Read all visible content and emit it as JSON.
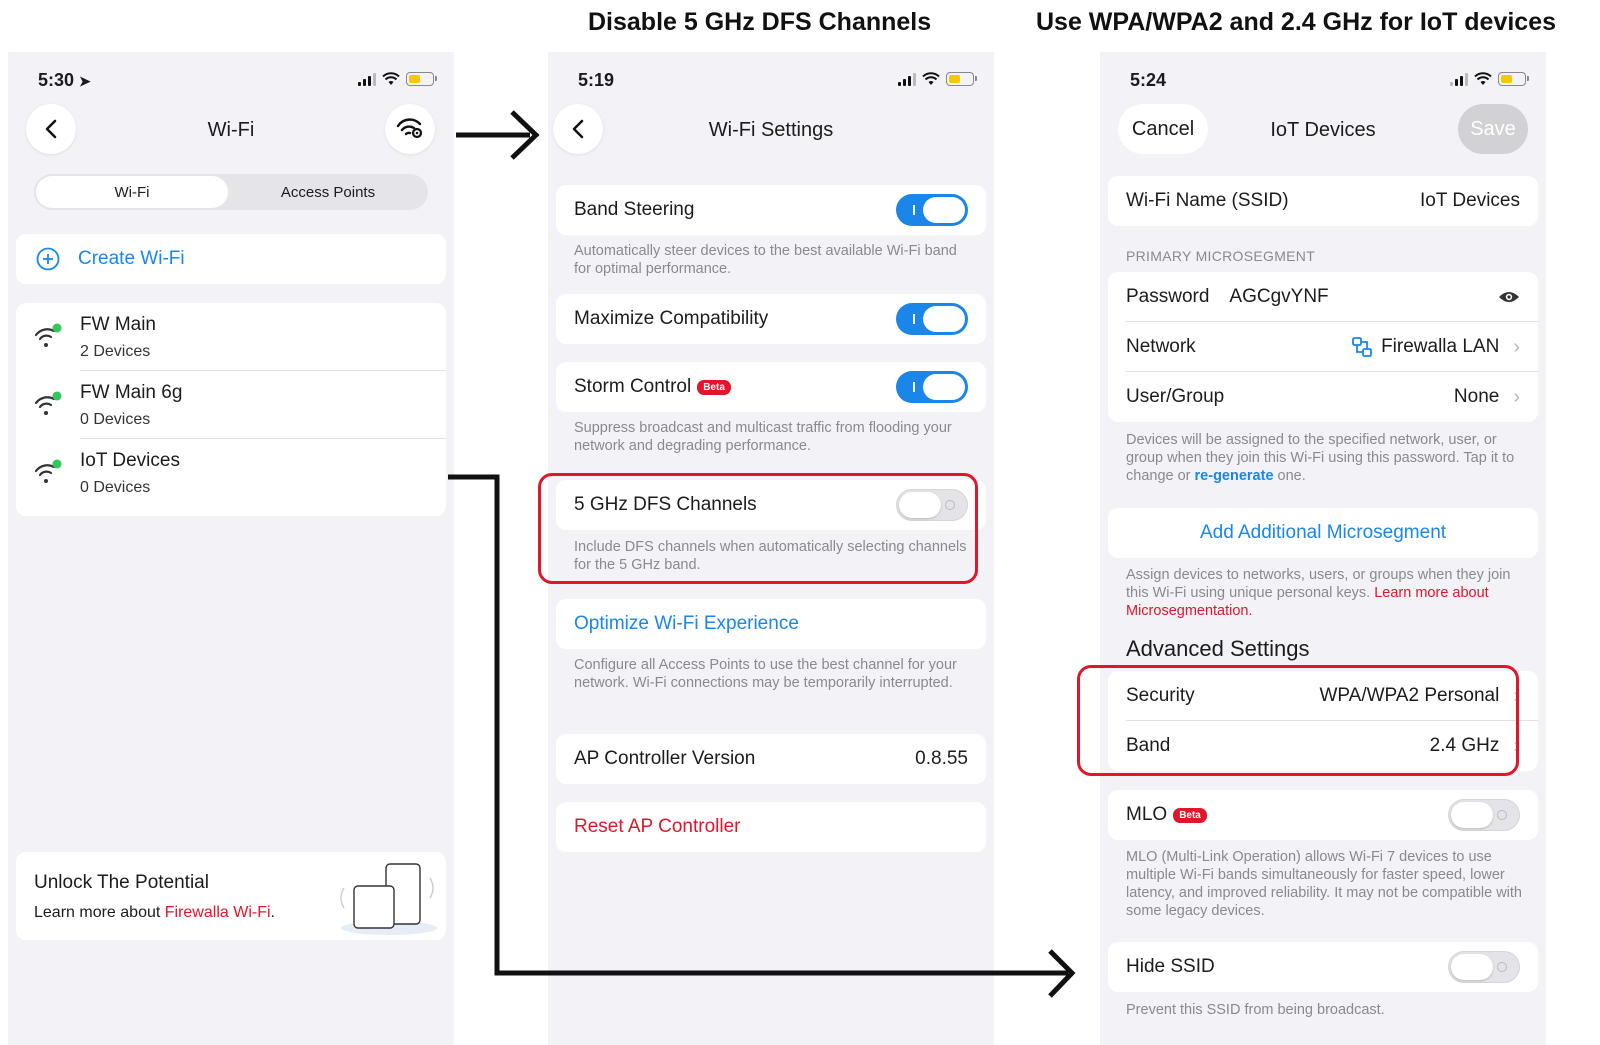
{
  "headings": {
    "middle": "Disable 5 GHz DFS Channels",
    "right": "Use WPA/WPA2 and 2.4 GHz for IoT devices"
  },
  "phone1": {
    "time": "5:30",
    "title": "Wi-Fi",
    "tabs": [
      "Wi-Fi",
      "Access Points"
    ],
    "create_label": "Create Wi-Fi",
    "networks": [
      {
        "name": "FW Main",
        "devices": "2 Devices"
      },
      {
        "name": "FW Main 6g",
        "devices": "0 Devices"
      },
      {
        "name": "IoT Devices",
        "devices": "0 Devices"
      }
    ],
    "promo": {
      "title": "Unlock The Potential",
      "text_prefix": "Learn more about ",
      "link": "Firewalla Wi-Fi",
      "text_suffix": "."
    }
  },
  "phone2": {
    "time": "5:19",
    "title": "Wi-Fi Settings",
    "band_steering": {
      "label": "Band Steering",
      "enabled": true,
      "note": "Automatically steer devices to the best available Wi-Fi band for optimal performance."
    },
    "max_compat": {
      "label": "Maximize Compatibility",
      "enabled": true
    },
    "storm_control": {
      "label": "Storm Control",
      "badge": "Beta",
      "enabled": true,
      "note": "Suppress broadcast and multicast traffic from flooding your network and degrading performance."
    },
    "dfs": {
      "label": "5 GHz DFS Channels",
      "enabled": false,
      "note": "Include DFS channels when automatically selecting channels for the 5 GHz band."
    },
    "optimize": {
      "label": "Optimize Wi-Fi Experience",
      "note": "Configure all Access Points to use the best channel for your network. Wi-Fi connections may be temporarily interrupted."
    },
    "ap_version": {
      "label": "AP Controller Version",
      "value": "0.8.55"
    },
    "reset_label": "Reset AP Controller"
  },
  "phone3": {
    "time": "5:24",
    "cancel": "Cancel",
    "title": "IoT Devices",
    "save": "Save",
    "ssid": {
      "label": "Wi-Fi Name (SSID)",
      "value": "IoT Devices"
    },
    "section_primary": "PRIMARY MICROSEGMENT",
    "password": {
      "label": "Password",
      "value": "AGCgvYNF"
    },
    "network": {
      "label": "Network",
      "value": "Firewalla LAN"
    },
    "user_group": {
      "label": "User/Group",
      "value": "None"
    },
    "assign_note": {
      "prefix": "Devices will be assigned to the specified network, user, or group when they join this Wi-Fi using this password. Tap it to change or ",
      "link": "re-generate",
      "suffix": " one."
    },
    "add_micro": "Add Additional Microsegment",
    "micro_note": {
      "prefix": "Assign devices to networks, users, or groups when they join this Wi-Fi using unique personal keys. ",
      "link": "Learn more about Microsegmentation."
    },
    "advanced_title": "Advanced Settings",
    "security": {
      "label": "Security",
      "value": "WPA/WPA2 Personal"
    },
    "band": {
      "label": "Band",
      "value": "2.4 GHz"
    },
    "mlo": {
      "label": "MLO",
      "badge": "Beta",
      "enabled": false,
      "note": "MLO (Multi-Link Operation) allows Wi-Fi 7 devices to use multiple Wi-Fi bands simultaneously for faster speed, lower latency, and improved reliability. It may not be compatible with some legacy devices."
    },
    "hide_ssid": {
      "label": "Hide SSID",
      "enabled": false,
      "note": "Prevent this SSID from being broadcast."
    }
  },
  "colors": {
    "accent_blue": "#1a86e8",
    "accent_red": "#e1162a",
    "status_green": "#34c759"
  }
}
